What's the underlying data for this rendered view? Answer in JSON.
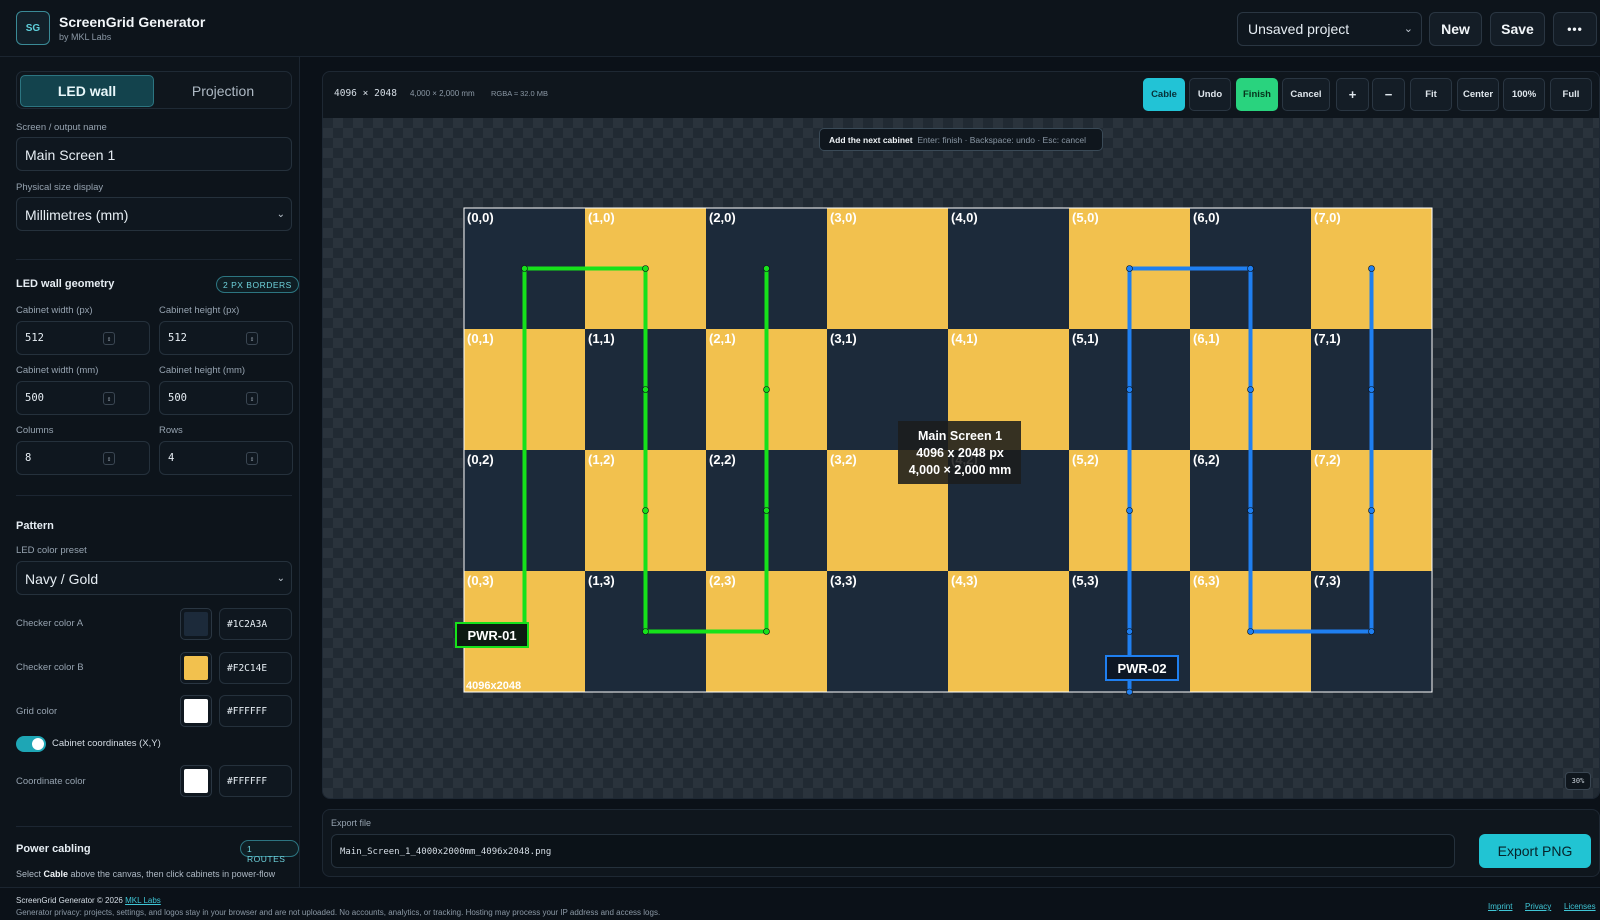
{
  "header": {
    "logo_text": "SG",
    "title": "ScreenGrid Generator",
    "subtitle": "by MKL Labs",
    "project_select": "Unsaved project",
    "new_label": "New",
    "save_label": "Save",
    "more_label": "•••"
  },
  "sidebar": {
    "tab_led": "LED wall",
    "tab_projection": "Projection",
    "screen_name_label": "Screen / output name",
    "screen_name_value": "Main Screen 1",
    "size_display_label": "Physical size display",
    "size_display_value": "Millimetres (mm)",
    "geometry_title": "LED wall geometry",
    "geometry_badge": "2 PX BORDERS",
    "cab_width_px_label": "Cabinet width (px)",
    "cab_width_px": "512",
    "cab_height_px_label": "Cabinet height (px)",
    "cab_height_px": "512",
    "cab_width_mm_label": "Cabinet width (mm)",
    "cab_width_mm": "500",
    "cab_height_mm_label": "Cabinet height (mm)",
    "cab_height_mm": "500",
    "columns_label": "Columns",
    "columns": "8",
    "rows_label": "Rows",
    "rows": "4",
    "pattern_title": "Pattern",
    "preset_label": "LED color preset",
    "preset_value": "Navy / Gold",
    "checker_a_label": "Checker color A",
    "checker_a": "#1C2A3A",
    "checker_b_label": "Checker color B",
    "checker_b": "#F2C14E",
    "grid_color_label": "Grid color",
    "grid_color": "#FFFFFF",
    "coords_toggle_label": "Cabinet coordinates (X,Y)",
    "coord_color_label": "Coordinate color",
    "coord_color": "#FFFFFF",
    "power_title": "Power cabling",
    "power_badge": "1 ROUTES",
    "power_hint_pre": "Select ",
    "power_hint_bold": "Cable",
    "power_hint_post": " above the canvas, then click cabinets in power-flow"
  },
  "canvas_bar": {
    "dim_w": "4096",
    "dim_x": "×",
    "dim_h": "2048",
    "dim_mm": "4,000 × 2,000 mm",
    "rgba": "RGBA ≈ 32.0 MB",
    "buttons": {
      "cable": "Cable",
      "undo": "Undo",
      "finish": "Finish",
      "cancel": "Cancel",
      "zoom_in": "+",
      "zoom_out": "−",
      "fit": "Fit",
      "center": "Center",
      "hundred": "100%",
      "full": "Full"
    }
  },
  "canvas": {
    "hint_bold": "Add the next cabinet",
    "hint_rest": "Enter: finish · Backspace: undo · Esc: cancel",
    "center_line1": "Main Screen 1",
    "center_line2": "4096 x 2048 px",
    "center_line3": "4,000 × 2,000 mm",
    "corner_label": "4096x2048",
    "zoom_level": "30%",
    "columns": 8,
    "rows": 4,
    "route1_label": "PWR-01",
    "route1_color": "#16e11a",
    "route2_label": "PWR-02",
    "route2_color": "#1f7ff0"
  },
  "export": {
    "label": "Export file",
    "filename": "Main_Screen_1_4000x2000mm_4096x2048.png",
    "button": "Export PNG"
  },
  "footer": {
    "copyright": "ScreenGrid Generator © 2026",
    "company_link": "MKL Labs",
    "privacy_note": "Generator privacy: projects, settings, and logos stay in your browser and are not uploaded. No accounts, analytics, or tracking. Hosting may process your IP address and access logs.",
    "imprint": "Imprint",
    "privacy": "Privacy",
    "licenses": "Licenses"
  }
}
